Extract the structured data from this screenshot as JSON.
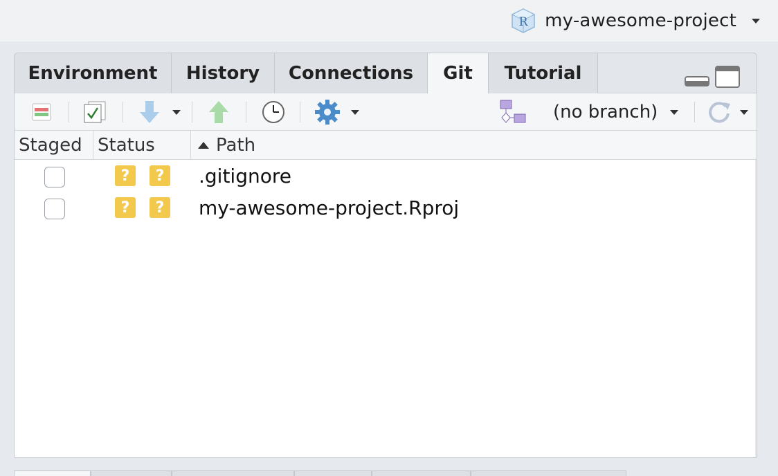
{
  "project": {
    "name": "my-awesome-project",
    "icon": "r-project-cube-icon"
  },
  "tabs": [
    {
      "label": "Environment",
      "active": false
    },
    {
      "label": "History",
      "active": false
    },
    {
      "label": "Connections",
      "active": false
    },
    {
      "label": "Git",
      "active": true
    },
    {
      "label": "Tutorial",
      "active": false
    }
  ],
  "toolbar": {
    "branch": "(no branch)",
    "tools": [
      "diff-icon",
      "commit-icon",
      "pull-icon",
      "push-icon",
      "history-icon",
      "gear-icon",
      "new-branch-icon",
      "refresh-icon"
    ]
  },
  "columns": {
    "staged": "Staged",
    "status": "Status",
    "path": "Path"
  },
  "files": [
    {
      "path": ".gitignore",
      "status_index": "?",
      "status_worktree": "?",
      "staged": false
    },
    {
      "path": "my-awesome-project.Rproj",
      "status_index": "?",
      "status_worktree": "?",
      "staged": false
    }
  ],
  "colors": {
    "untracked_badge": "#f2c94c",
    "tab_active": "#f5f6f8"
  }
}
